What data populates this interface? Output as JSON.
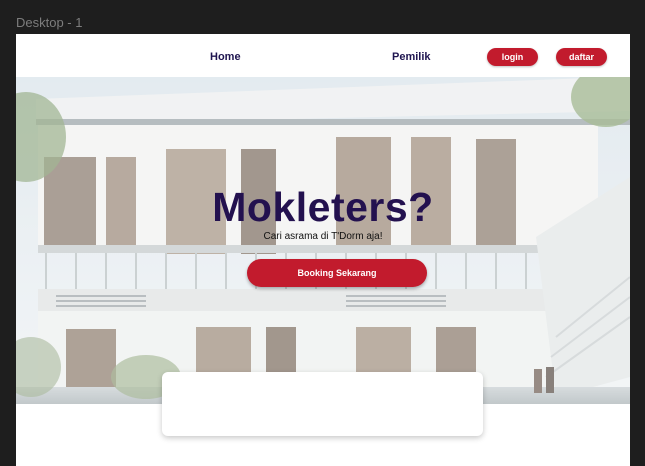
{
  "frame": {
    "label": "Desktop - 1"
  },
  "nav": {
    "home": "Home",
    "owner": "Pemilik",
    "login": "login",
    "register": "daftar"
  },
  "hero": {
    "title": "Mokleters?",
    "subtitle": "Cari asrama di T'Dorm aja!",
    "cta": "Booking Sekarang"
  },
  "colors": {
    "brand_red": "#c21b2d",
    "title_navy": "#23114f",
    "nav_text": "#1f1550",
    "canvas": "#1e1e1e"
  }
}
